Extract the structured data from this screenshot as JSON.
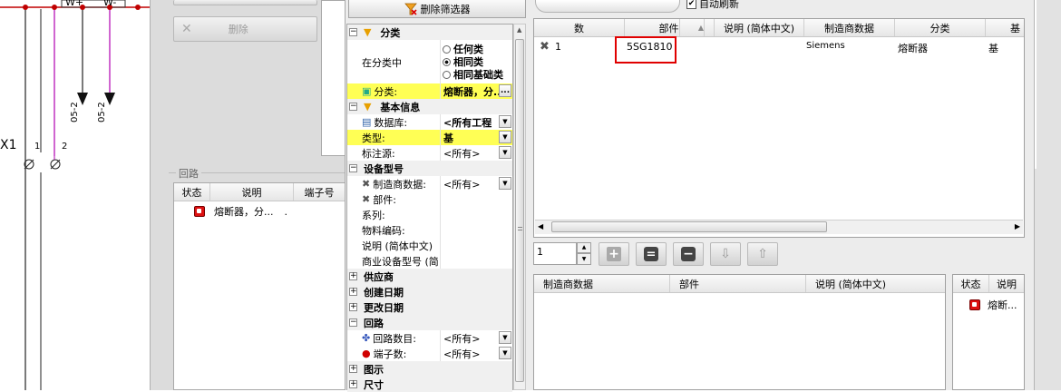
{
  "schematic": {
    "label_x1": "X1",
    "terminal_1": "1",
    "terminal_2": "2",
    "arrow_label_1": "05-2",
    "arrow_label_2": "05-2",
    "wire_label_1": "W+",
    "wire_label_2": "W-"
  },
  "middle": {
    "delete_button": "删除",
    "group_title": "回路",
    "columns": [
      "状态",
      "说明",
      "端子号"
    ],
    "row": {
      "description": "熔断器，分...",
      "dot": "."
    }
  },
  "filter": {
    "remove_filter_button": "删除筛选器",
    "categories": {
      "classification": "分类",
      "basic_info": "基本信息",
      "device_type": "设备型号",
      "supplier": "供应商",
      "created_date": "创建日期",
      "changed_date": "更改日期",
      "circuit": "回路",
      "diagram": "图示",
      "dimensions": "尺寸"
    },
    "in_class_label": "在分类中",
    "radio_any": "任何类",
    "radio_same": "相同类",
    "radio_same_base": "相同基础类",
    "class_label": "分类:",
    "class_value": "熔断器，分...",
    "database_label": "数据库:",
    "database_value": "<所有工程",
    "type_label": "类型:",
    "type_value": "基",
    "mark_source_label": "标注源:",
    "mark_source_value": "<所有>",
    "manufacturer_data_label": "制造商数据:",
    "manufacturer_data_value": "<所有>",
    "part_label": "部件:",
    "series_label": "系列:",
    "material_code_label": "物料编码:",
    "description_label": "说明 (简体中文)",
    "commercial_type_label": "商业设备型号 (简",
    "circuit_count_label": "回路数目:",
    "circuit_count_value": "<所有>",
    "terminal_count_label": "端子数:",
    "terminal_count_value": "<所有>"
  },
  "top": {
    "auto_refresh": "自动刷新",
    "columns": [
      "数",
      "部件",
      "说明 (简体中文)",
      "制造商数据",
      "分类",
      "基"
    ],
    "rows": [
      {
        "num": "1",
        "part": "5SG1810",
        "description": "",
        "manufacturer": "Siemens",
        "class": "熔断器",
        "base": "基"
      }
    ]
  },
  "toolbar": {
    "spin_value": "1"
  },
  "bottom": {
    "columns": [
      "制造商数据",
      "部件",
      "说明 (简体中文)"
    ],
    "side_columns": [
      "状态",
      "说明"
    ],
    "side_row_text": "熔断..."
  },
  "colors": {
    "highlight": "#ffff55",
    "annotation_box": "#e00000",
    "magenta_wire": "#b000b0",
    "red_dot": "#c00000"
  }
}
